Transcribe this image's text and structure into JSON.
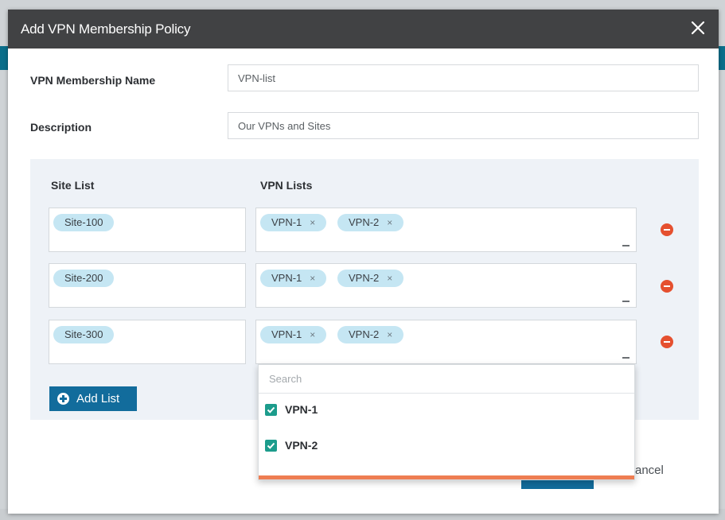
{
  "dialog": {
    "title": "Add VPN Membership Policy",
    "close_icon": "close-icon"
  },
  "form": {
    "name_label": "VPN Membership Name",
    "name_value": "VPN-list",
    "description_label": "Description",
    "description_value": "Our VPNs and Sites"
  },
  "lists": {
    "site_header": "Site List",
    "vpn_header": "VPN Lists",
    "rows": [
      {
        "site": "Site-100",
        "vpns": [
          "VPN-1",
          "VPN-2"
        ]
      },
      {
        "site": "Site-200",
        "vpns": [
          "VPN-1",
          "VPN-2"
        ]
      },
      {
        "site": "Site-300",
        "vpns": [
          "VPN-1",
          "VPN-2"
        ]
      }
    ],
    "chip_remove_glyph": "×",
    "add_list_label": "Add List"
  },
  "dropdown": {
    "search_placeholder": "Search",
    "options": [
      {
        "label": "VPN-1",
        "checked": true
      },
      {
        "label": "VPN-2",
        "checked": true
      }
    ]
  },
  "footer": {
    "cancel_partial": "ancel"
  },
  "colors": {
    "titlebar": "#414244",
    "chip": "#c5e6f3",
    "primary": "#126c9c",
    "remove": "#e5502f",
    "checkbox": "#1c9c8c",
    "accent": "#ee7d52"
  }
}
